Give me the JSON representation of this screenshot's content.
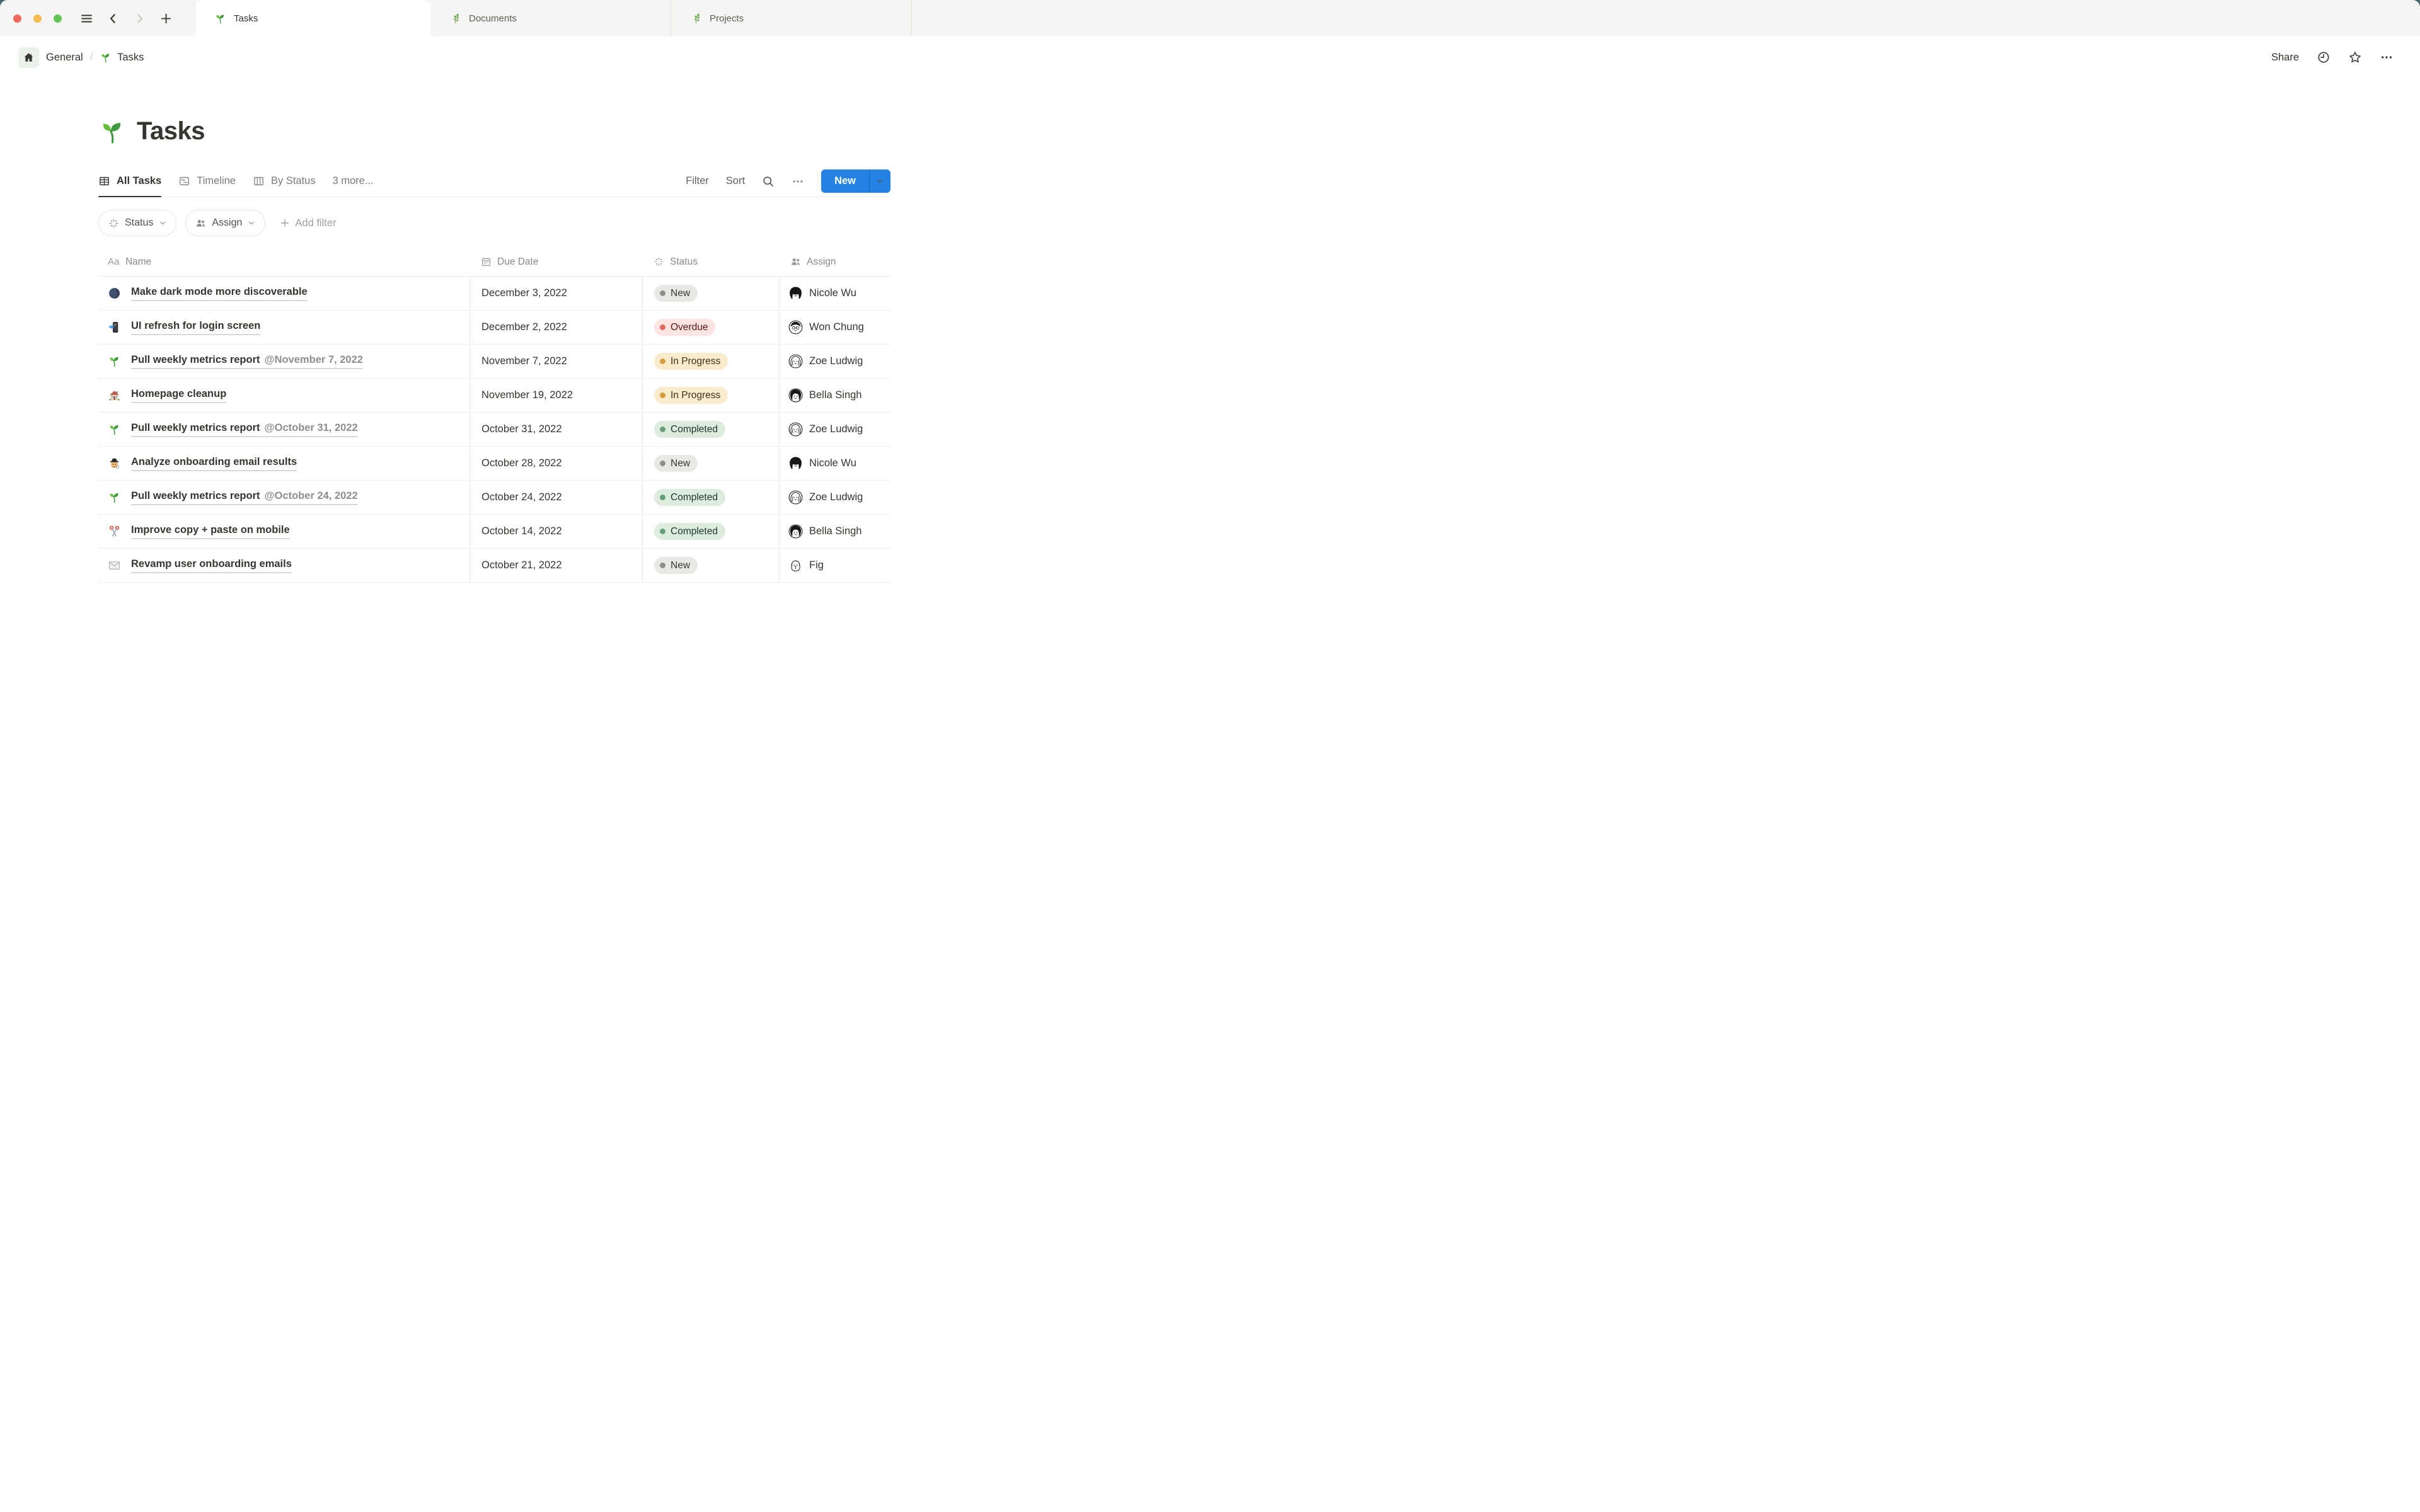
{
  "window": {
    "traffic_lights": {
      "close": "#EE6A5F",
      "minimize": "#F5BD4F",
      "zoom": "#61C454"
    },
    "tabs": [
      {
        "label": "Tasks",
        "icon": "seedling",
        "active": true
      },
      {
        "label": "Documents",
        "icon": "herb",
        "active": false
      },
      {
        "label": "Projects",
        "icon": "herb",
        "active": false
      }
    ]
  },
  "breadcrumb": {
    "workspace": "General",
    "separator": "/",
    "page": "Tasks",
    "page_icon": "seedling"
  },
  "topbar_actions": {
    "share_label": "Share"
  },
  "page": {
    "icon": "seedling",
    "title": "Tasks"
  },
  "view_bar": {
    "views": [
      {
        "label": "All Tasks",
        "icon": "table",
        "active": true
      },
      {
        "label": "Timeline",
        "icon": "timeline",
        "active": false
      },
      {
        "label": "By Status",
        "icon": "board",
        "active": false
      }
    ],
    "more_label": "3 more...",
    "filter_label": "Filter",
    "sort_label": "Sort",
    "new_button_label": "New"
  },
  "filter_bar": {
    "chips": [
      {
        "label": "Status",
        "icon": "status"
      },
      {
        "label": "Assign",
        "icon": "people"
      }
    ],
    "add_filter_label": "Add filter"
  },
  "table": {
    "columns": [
      {
        "label": "Name",
        "icon": "aa"
      },
      {
        "label": "Due Date",
        "icon": "calendar"
      },
      {
        "label": "Status",
        "icon": "status"
      },
      {
        "label": "Assign",
        "icon": "people"
      }
    ],
    "rows": [
      {
        "icon": "moon",
        "name": "Make dark mode more discoverable",
        "mention": "",
        "due": "December 3, 2022",
        "status": "New",
        "assignee": "Nicole Wu",
        "avatar": "nicole"
      },
      {
        "icon": "phone",
        "name": "UI refresh for login screen",
        "mention": "",
        "due": "December 2, 2022",
        "status": "Overdue",
        "assignee": "Won Chung",
        "avatar": "won"
      },
      {
        "icon": "seedling",
        "name": "Pull weekly metrics report",
        "mention": "@November 7, 2022",
        "due": "November 7, 2022",
        "status": "In Progress",
        "assignee": "Zoe Ludwig",
        "avatar": "zoe"
      },
      {
        "icon": "house",
        "name": "Homepage cleanup",
        "mention": "",
        "due": "November 19, 2022",
        "status": "In Progress",
        "assignee": "Bella Singh",
        "avatar": "bella"
      },
      {
        "icon": "seedling",
        "name": "Pull weekly metrics report",
        "mention": "@October 31, 2022",
        "due": "October 31, 2022",
        "status": "Completed",
        "assignee": "Zoe Ludwig",
        "avatar": "zoe"
      },
      {
        "icon": "detective",
        "name": "Analyze onboarding email results",
        "mention": "",
        "due": "October 28, 2022",
        "status": "New",
        "assignee": "Nicole Wu",
        "avatar": "nicole"
      },
      {
        "icon": "seedling",
        "name": "Pull weekly metrics report",
        "mention": "@October 24, 2022",
        "due": "October 24, 2022",
        "status": "Completed",
        "assignee": "Zoe Ludwig",
        "avatar": "zoe"
      },
      {
        "icon": "scissors",
        "name": "Improve copy + paste on mobile",
        "mention": "",
        "due": "October 14, 2022",
        "status": "Completed",
        "assignee": "Bella Singh",
        "avatar": "bella"
      },
      {
        "icon": "envelope",
        "name": "Revamp user onboarding emails",
        "mention": "",
        "due": "October 21, 2022",
        "status": "New",
        "assignee": "Fig",
        "avatar": "fig"
      }
    ]
  },
  "status_styles": {
    "New": {
      "bg": "#E9E8E5",
      "dot": "#8E8D8A",
      "text": "#383632"
    },
    "Overdue": {
      "bg": "#FBE4E1",
      "dot": "#E06C5F",
      "text": "#5D1715"
    },
    "In Progress": {
      "bg": "#FAEBCC",
      "dot": "#D29E3F",
      "text": "#41301B"
    },
    "Completed": {
      "bg": "#DDECDC",
      "dot": "#689E77",
      "text": "#1F3829"
    }
  },
  "accent_color": "#2482E3"
}
